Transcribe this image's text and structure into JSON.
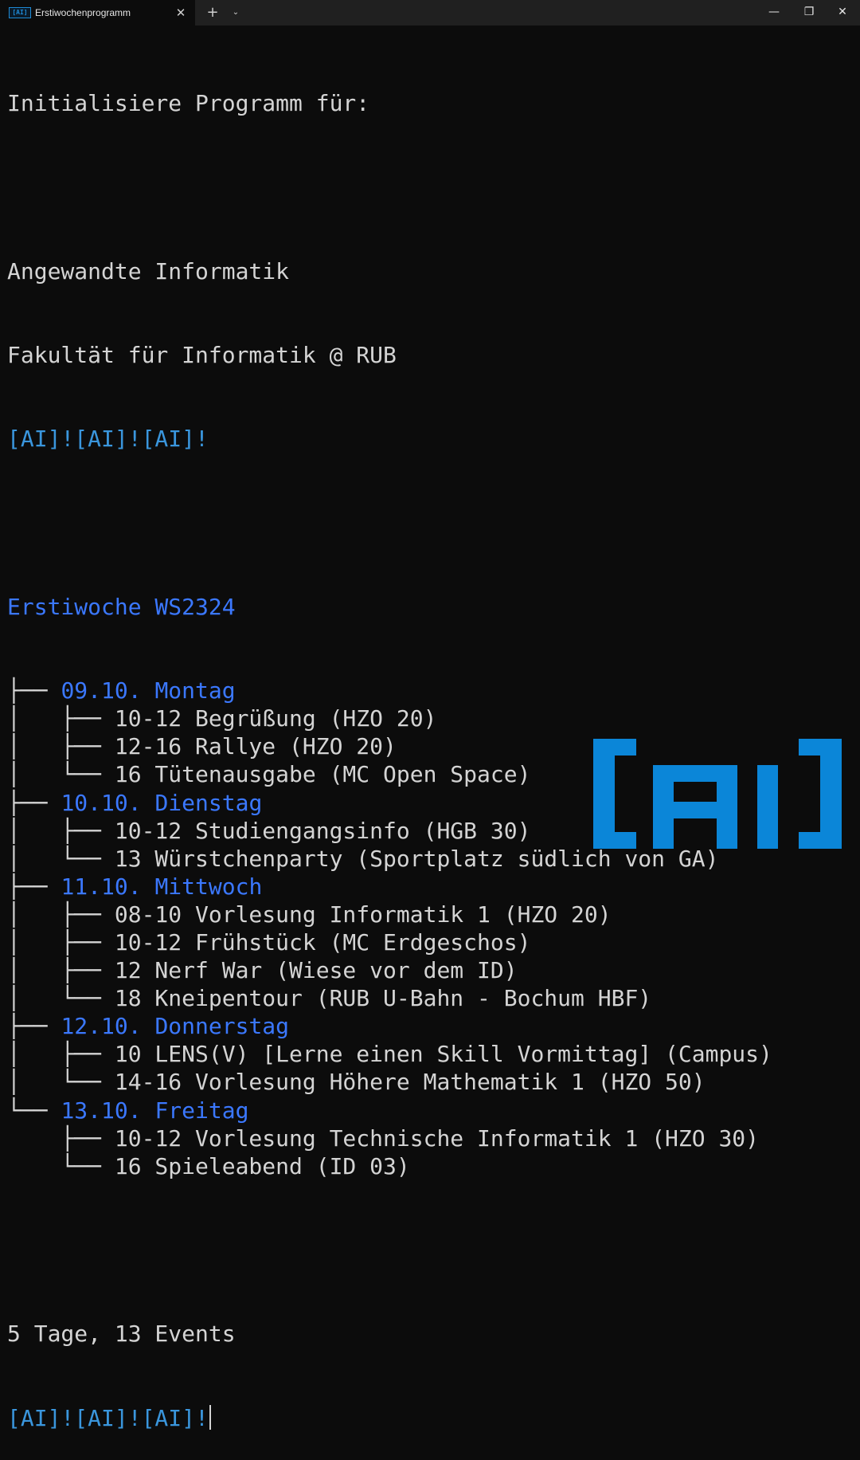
{
  "window": {
    "tab_icon": "[AI]",
    "tab_title": "Erstiwochenprogramm",
    "tab_close": "✕",
    "new_tab": "+",
    "tab_menu": "⌄",
    "minimize": "—",
    "maximize": "❐",
    "close": "✕"
  },
  "terminal": {
    "intro": "Initialisiere Programm für:",
    "program": "Angewandte Informatik",
    "faculty": "Fakultät für Informatik @ RUB",
    "cheer": "[AI]![AI]![AI]!",
    "tree_root": "Erstiwoche WS2324",
    "days": [
      {
        "prefix": "├── ",
        "label": "09.10. Montag",
        "events": [
          {
            "prefix": "│   ├── ",
            "text": "10-12 Begrüßung (HZO 20)"
          },
          {
            "prefix": "│   ├── ",
            "text": "12-16 Rallye (HZO 20)"
          },
          {
            "prefix": "│   └── ",
            "text": "16 Tütenausgabe (MC Open Space)"
          }
        ]
      },
      {
        "prefix": "├── ",
        "label": "10.10. Dienstag",
        "events": [
          {
            "prefix": "│   ├── ",
            "text": "10-12 Studiengangsinfo (HGB 30)"
          },
          {
            "prefix": "│   └── ",
            "text": "13 Würstchenparty (Sportplatz südlich von GA)"
          }
        ]
      },
      {
        "prefix": "├── ",
        "label": "11.10. Mittwoch",
        "events": [
          {
            "prefix": "│   ├── ",
            "text": "08-10 Vorlesung Informatik 1 (HZO 20)"
          },
          {
            "prefix": "│   ├── ",
            "text": "10-12 Frühstück (MC Erdgeschos)"
          },
          {
            "prefix": "│   ├── ",
            "text": "12 Nerf War (Wiese vor dem ID)"
          },
          {
            "prefix": "│   └── ",
            "text": "18 Kneipentour (RUB U-Bahn - Bochum HBF)"
          }
        ]
      },
      {
        "prefix": "├── ",
        "label": "12.10. Donnerstag",
        "events": [
          {
            "prefix": "│   ├── ",
            "text": "10 LENS(V) [Lerne einen Skill Vormittag] (Campus)"
          },
          {
            "prefix": "│   └── ",
            "text": "14-16 Vorlesung Höhere Mathematik 1 (HZO 50)"
          }
        ]
      },
      {
        "prefix": "└── ",
        "label": "13.10. Freitag",
        "events": [
          {
            "prefix": "    ├── ",
            "text": "10-12 Vorlesung Technische Informatik 1 (HZO 30)"
          },
          {
            "prefix": "    └── ",
            "text": "16 Spieleabend (ID 03)"
          }
        ]
      }
    ],
    "summary": "5 Tage, 13 Events",
    "prompt": "[AI]![AI]![AI]!"
  },
  "logo": {
    "text": "[AI]",
    "color": "#0b86d8"
  },
  "colors": {
    "background": "#0c0c0c",
    "text": "#d4d4d4",
    "day": "#3b78ff",
    "cheer": "#3a96dd"
  }
}
